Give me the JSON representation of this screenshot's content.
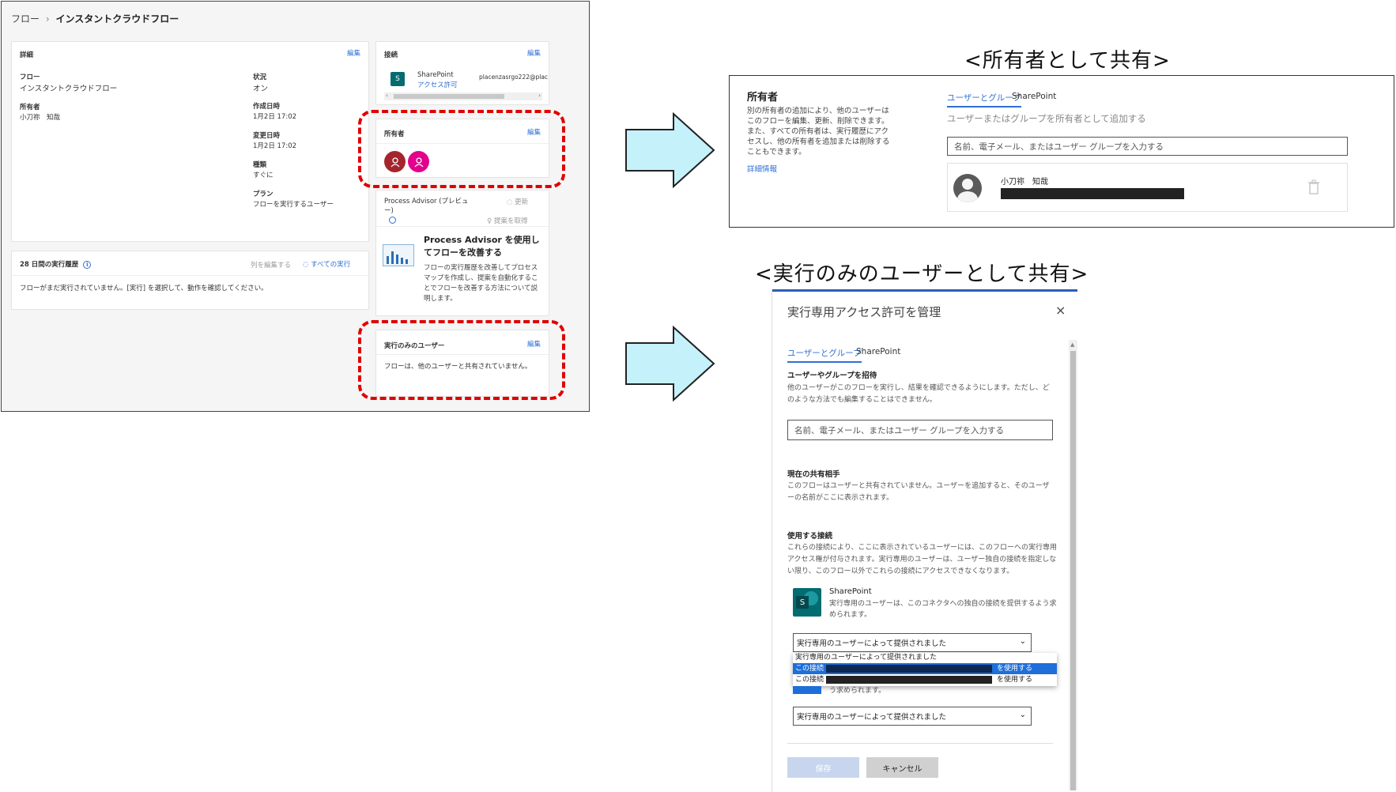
{
  "flow_page": {
    "breadcrumb": {
      "root": "フロー",
      "separator": "›",
      "current": "インスタントクラウドフロー"
    },
    "details": {
      "title": "詳細",
      "edit": "編集",
      "flow_label": "フロー",
      "flow_value": "インスタントクラウドフロー",
      "owner_label": "所有者",
      "owner_value": "小刀祢　知哉",
      "status_label": "状況",
      "status_value": "オン",
      "created_label": "作成日時",
      "created_value": "1月2日 17:02",
      "modified_label": "変更日時",
      "modified_value": "1月2日 17:02",
      "type_label": "種類",
      "type_value": "すぐに",
      "plan_label": "プラン",
      "plan_value": "フローを実行するユーザー"
    },
    "history": {
      "title": "28 日間の実行履歴",
      "edit_columns": "列を編集する",
      "all_runs": "すべての実行",
      "empty_message": "フローがまだ実行されていません。[実行] を選択して、動作を確認してください。"
    },
    "connections": {
      "title": "接続",
      "edit": "編集",
      "service": "SharePoint",
      "permission": "アクセス許可",
      "account": "placenzasrgo222@plac"
    },
    "owners": {
      "title": "所有者",
      "edit": "編集"
    },
    "process_advisor": {
      "title": "Process Advisor (プレビュー)",
      "refresh": "更新",
      "get_suggestions": "提案を取得",
      "promo_title": "Process Advisor を使用してフローを改善する",
      "promo_body": "フローの実行履歴を改善してプロセス マップを作成し、提案を自動化することでフローを改善する方法について説明します。"
    },
    "run_only": {
      "title": "実行のみのユーザー",
      "edit": "編集",
      "message": "フローは、他のユーザーと共有されていません。"
    }
  },
  "owner_section": {
    "heading": "<所有者として共有>",
    "title": "所有者",
    "description": "別の所有者の追加により、他のユーザーはこのフローを編集、更新、削除できます。また、すべての所有者は、実行履歴にアクセスし、他の所有者を追加または削除することもできます。",
    "more_info": "詳細情報",
    "tabs": [
      "ユーザーとグループ",
      "SharePoint"
    ],
    "hint": "ユーザーまたはグループを所有者として追加する",
    "input_placeholder": "名前、電子メール、またはユーザー グループを入力する",
    "user_name": "小刀祢　知哉"
  },
  "runonly_section": {
    "heading": "<実行のみのユーザーとして共有>",
    "panel_title": "実行専用アクセス許可を管理",
    "tabs": [
      "ユーザーとグループ",
      "SharePoint"
    ],
    "invite_title": "ユーザーやグループを招待",
    "invite_desc": "他のユーザーがこのフローを実行し、結果を確認できるようにします。ただし、どのような方法でも編集することはできません。",
    "input_placeholder": "名前、電子メール、またはユーザー グループを入力する",
    "shared_title": "現在の共有相手",
    "shared_desc": "このフローはユーザーと共有されていません。ユーザーを追加すると、そのユーザーの名前がここに表示されます。",
    "connections_title": "使用する接続",
    "connections_desc": "これらの接続により、ここに表示されているユーザーには、このフローへの実行専用アクセス権が付与されます。実行専用のユーザーは、ユーザー独自の接続を指定しない限り、このフロー以外でこれらの接続にアクセスできなくなります。",
    "sp_name": "SharePoint",
    "sp_desc": "実行専用のユーザーは、このコネクタへの独自の接続を提供するよう求められます。",
    "select_value": "実行専用のユーザーによって提供されました",
    "dropdown_options": [
      "実行専用のユーザーによって提供されました",
      "この接続 (",
      "この接続 ("
    ],
    "use_suffix": "を使用する",
    "hidden_desc": "う求められます。",
    "select_value_2": "実行専用のユーザーによって提供されました",
    "save": "保存",
    "cancel": "キャンセル"
  }
}
